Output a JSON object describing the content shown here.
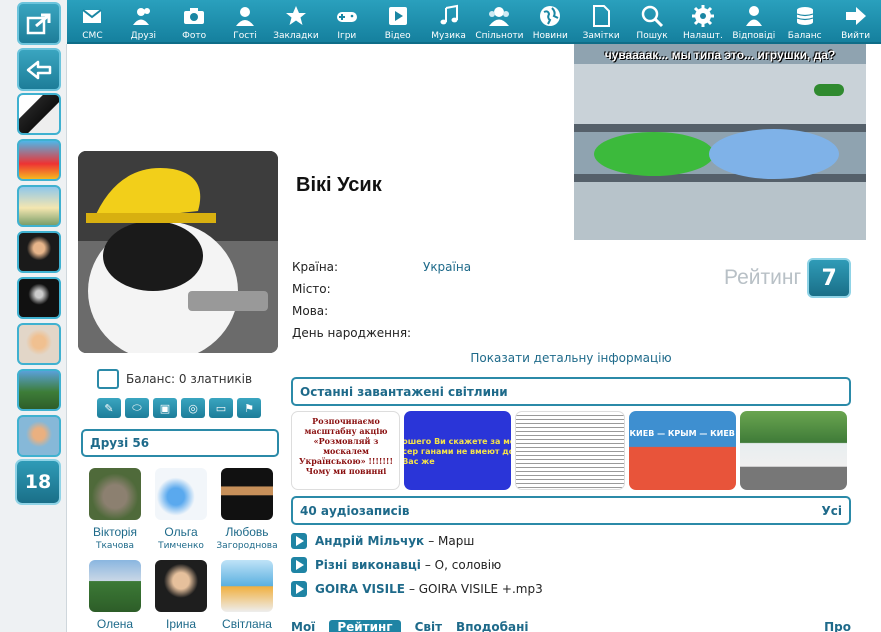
{
  "toolbar": {
    "items": [
      {
        "label": "СМС",
        "icon": "envelope-icon"
      },
      {
        "label": "Друзі",
        "icon": "users-icon"
      },
      {
        "label": "Фото",
        "icon": "camera-icon"
      },
      {
        "label": "Гості",
        "icon": "user-icon"
      },
      {
        "label": "Закладки",
        "icon": "star-icon"
      },
      {
        "label": "Ігри",
        "icon": "gamepad-icon"
      },
      {
        "label": "Відео",
        "icon": "play-icon"
      },
      {
        "label": "Музика",
        "icon": "music-icon"
      },
      {
        "label": "Спільноти",
        "icon": "group-icon"
      },
      {
        "label": "Новини",
        "icon": "globe-icon"
      },
      {
        "label": "Замітки",
        "icon": "note-icon"
      },
      {
        "label": "Пошук",
        "icon": "search-icon"
      },
      {
        "label": "Налашт.",
        "icon": "gear-icon"
      },
      {
        "label": "Відповіді",
        "icon": "person-icon"
      },
      {
        "label": "Баланс",
        "icon": "coins-icon"
      },
      {
        "label": "Вийти",
        "icon": "exit-arrow-icon"
      }
    ]
  },
  "rail": {
    "badge": "18"
  },
  "profile": {
    "name": "Вікі Усик",
    "banner_caption": "чуваааак... мы типа это... игрушки, да?",
    "info": [
      {
        "label": "Країна:",
        "value": "Україна"
      },
      {
        "label": "Місто:",
        "value": ""
      },
      {
        "label": "Мова:",
        "value": ""
      },
      {
        "label": "День народження:",
        "value": ""
      }
    ],
    "rating_label": "Рейтинг",
    "rating_value": "7",
    "more_info_link": "Показати детальну інформацію",
    "balance": "Баланс: 0 златників"
  },
  "friends": {
    "title": "Друзі 56",
    "list": [
      {
        "first": "Вікторія",
        "last": "Ткачова"
      },
      {
        "first": "Ольга",
        "last": "Тимченко"
      },
      {
        "first": "Любовь",
        "last": "Загороднова"
      },
      {
        "first": "Олена",
        "last": ""
      },
      {
        "first": "Ірина",
        "last": ""
      },
      {
        "first": "Світлана",
        "last": ""
      }
    ]
  },
  "photos": {
    "title": "Останні завантажені світлини",
    "items": [
      {
        "caption": "Розпочинаємо масштабну акцію «Розмовляй з москалем Українською» !!!!!!! Чому ми повинні"
      },
      {
        "caption": "ошего Ви скажете за мон сер ганами не вмеют до Вас же"
      },
      {
        "caption": ""
      },
      {
        "caption": "КИЕВ — КРЫМ — КИЕВ"
      },
      {
        "caption": ""
      }
    ]
  },
  "audio": {
    "title": "40 аудіозаписів",
    "all_link": "Усі",
    "tracks": [
      {
        "artist": "Андрій Мільчук",
        "title": "– Марш"
      },
      {
        "artist": "Різні виконавці",
        "title": "– О, соловію"
      },
      {
        "artist": "GOIRA VISILE",
        "title": "– GOIRA VISILE +.mp3"
      }
    ]
  },
  "bottom_tabs": [
    "Мої",
    "Рейтинг",
    "Світ",
    "Вподобані",
    "Про"
  ]
}
